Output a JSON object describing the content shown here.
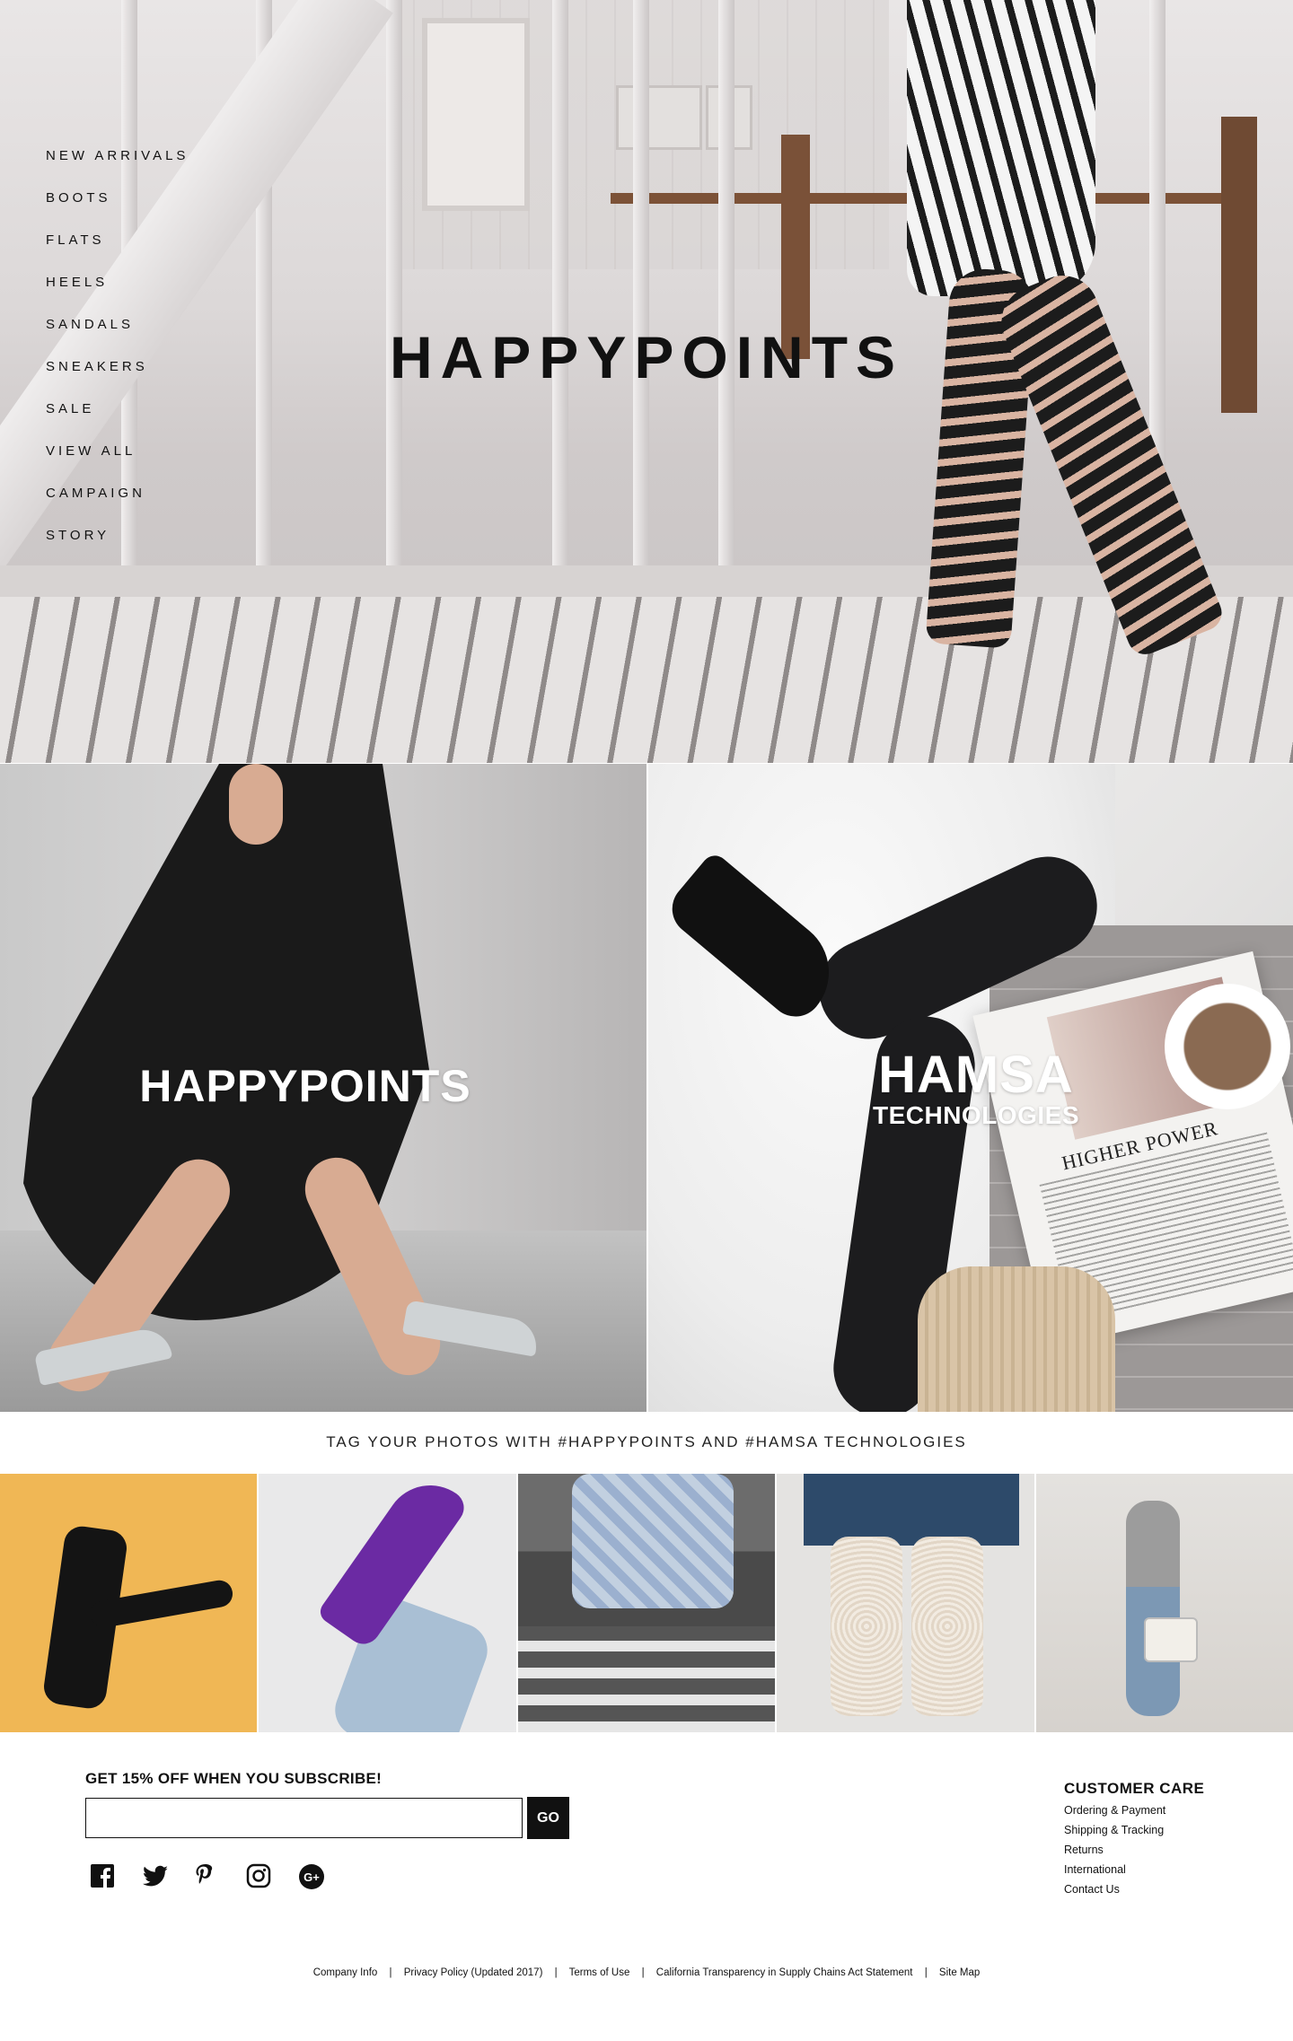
{
  "nav": {
    "items": [
      "NEW ARRIVALS",
      "BOOTS",
      "FLATS",
      "HEELS",
      "SANDALS",
      "SNEAKERS",
      "SALE",
      "VIEW ALL",
      "CAMPAIGN",
      "STORY"
    ]
  },
  "hero": {
    "title": "HAPPYPOINTS"
  },
  "tiles": {
    "left": {
      "title": "HAPPYPOINTS"
    },
    "right": {
      "title": "HAMSA",
      "subtitle": "TECHNOLOGIES",
      "magazine_headline": "HIGHER POWER"
    }
  },
  "tag_line": "TAG YOUR PHOTOS WITH #HAPPYPOINTS AND #HAMSA TECHNOLOGIES",
  "subscribe": {
    "title": "GET 15% OFF WHEN YOU SUBSCRIBE!",
    "input_value": "",
    "button_label": "GO"
  },
  "socials": [
    "facebook-icon",
    "twitter-icon",
    "pinterest-icon",
    "instagram-icon",
    "google-plus-icon"
  ],
  "customer_care": {
    "title": "CUSTOMER CARE",
    "links": [
      "Ordering & Payment",
      "Shipping & Tracking",
      "Returns",
      "International",
      "Contact Us"
    ]
  },
  "legal": {
    "links": [
      "Company Info",
      "Privacy Policy (Updated 2017)",
      "Terms of Use",
      "California Transparency in Supply Chains Act Statement",
      "Site Map"
    ],
    "separator": "|"
  },
  "colors": {
    "text": "#111111",
    "button": "#111111",
    "background": "#ffffff"
  }
}
